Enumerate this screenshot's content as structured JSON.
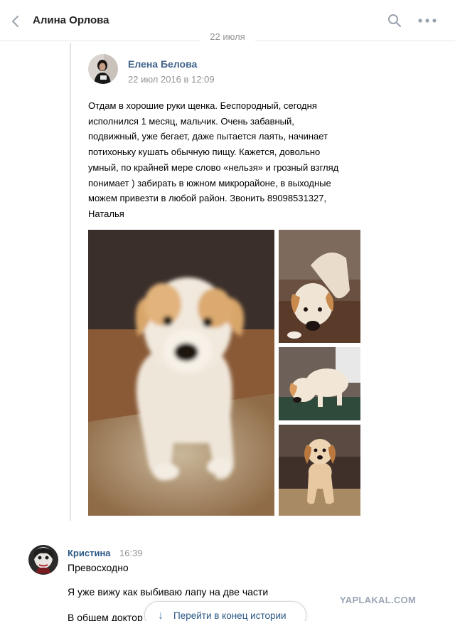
{
  "header": {
    "title": "Алина Орлова",
    "back_icon": "chevron-left-icon",
    "search_icon": "search-icon",
    "more_icon": "more-horizontal-icon"
  },
  "date_separator": "22 июля",
  "post": {
    "author": "Елена Белова",
    "date": "22 июл 2016 в 12:09",
    "text_lines": [
      "Отдам в хорошие руки щенка. Беспородный, сегодня",
      "исполнился 1 месяц, мальчик. Очень забавный,",
      "подвижный, уже бегает, даже пытается лаять, начинает",
      "потихоньку кушать обычную пищу. Кажется, довольно",
      "умный, по крайней мере слово «нельзя» и грозный взгляд",
      "понимает ) забирать в южном микрорайоне, в выходные",
      "можем привезти в любой район. Звонить 89098531327,",
      "Наталья"
    ]
  },
  "comment": {
    "author": "Кристина",
    "time": "16:39",
    "lines": [
      "Превосходно",
      "Я уже вижу как выбиваю лапу на две части",
      "В общем доктор"
    ]
  },
  "jump_button": {
    "label": "Перейти в конец истории",
    "icon": "arrow-down-icon"
  },
  "watermark": "YAPLAKAL.COM",
  "colors": {
    "link": "#2a5885",
    "accent": "#5181b8",
    "muted": "#939393",
    "border": "#dfe3e8"
  }
}
